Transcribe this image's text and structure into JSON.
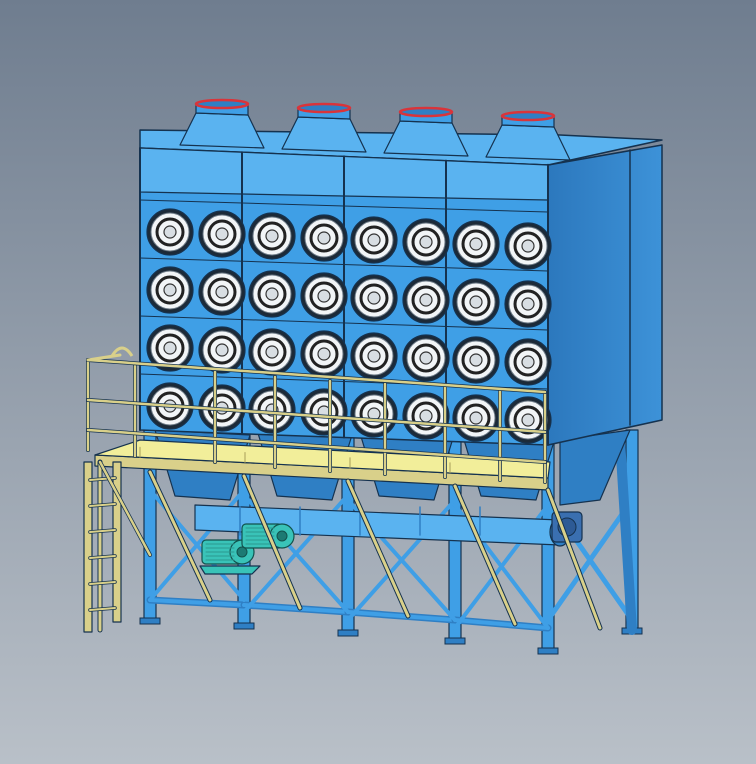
{
  "scene": {
    "subject": "cartridge-dust-collector-cad-model",
    "colors": {
      "background_top": "#6f7d8f",
      "background_bottom": "#b9c0c8",
      "body_blue": "#3f9fe6",
      "body_blue_dark": "#2f7fc4",
      "body_blue_light": "#5ab3f0",
      "edge": "#15324f",
      "catwalk_yellow": "#f2ee9a",
      "railing_yellow": "#d9d08a",
      "filter_white": "#f2f5f7",
      "motor_teal": "#39c3b8",
      "inlet_rim_red": "#d9343a"
    },
    "modules": 4,
    "filter_rows": 4,
    "filters_per_module_row": 2
  }
}
